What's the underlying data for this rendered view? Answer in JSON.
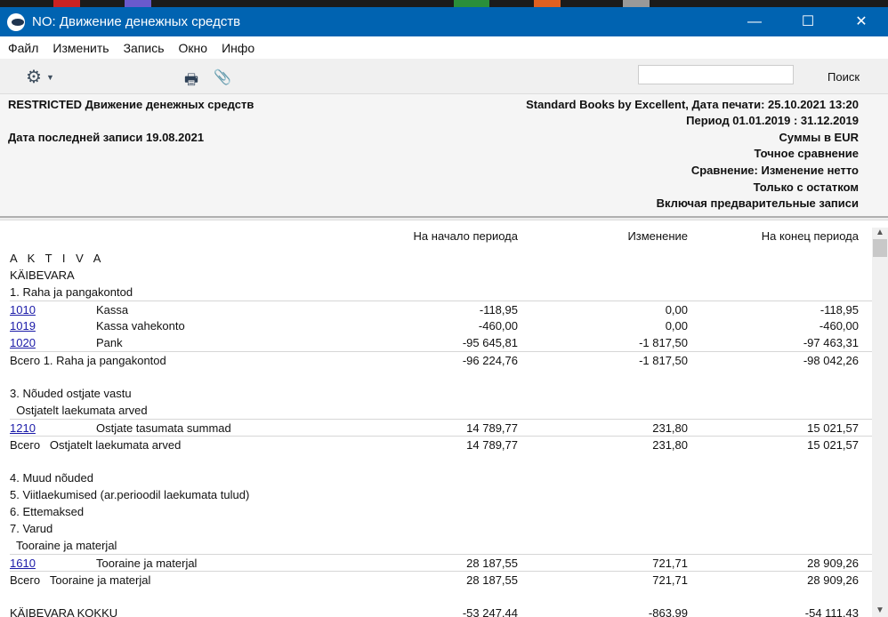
{
  "window": {
    "title": "NO: Движение денежных средств",
    "minimize": "—",
    "maximize": "☐",
    "close": "✕"
  },
  "menu": [
    "Файл",
    "Изменить",
    "Запись",
    "Окно",
    "Инфо"
  ],
  "toolbar": {
    "search_value": "",
    "search_label": "Поиск"
  },
  "report_header": {
    "title": "RESTRICTED Движение денежных средств",
    "last_entry": "Дата последней записи  19.08.2021",
    "right": [
      "Standard Books by Excellent, Дата печати: 25.10.2021 13:20",
      "Период  01.01.2019 : 31.12.2019",
      "Суммы в EUR",
      "Точное сравнение",
      "Сравнение: Изменение нетто",
      "Только с остатком",
      "Включая предварительные записи"
    ]
  },
  "columns": [
    "На начало периода",
    "Изменение",
    "На конец периода"
  ],
  "rows": [
    {
      "type": "spaced",
      "label": "A K T I V A"
    },
    {
      "type": "text",
      "label": "KÄIBEVARA"
    },
    {
      "type": "text",
      "label": "1. Raha ja pangakontod"
    },
    {
      "type": "account",
      "line": true,
      "code": "1010",
      "name": "Kassa",
      "v": [
        "-118,95",
        "0,00",
        "-118,95"
      ]
    },
    {
      "type": "account",
      "code": "1019",
      "name": "Kassa vahekonto",
      "v": [
        "-460,00",
        "0,00",
        "-460,00"
      ]
    },
    {
      "type": "account",
      "code": "1020",
      "name": "Pank",
      "v": [
        "-95 645,81",
        "-1 817,50",
        "-97 463,31"
      ]
    },
    {
      "type": "total",
      "line": true,
      "label": "Всего 1. Raha ja pangakontod",
      "v": [
        "-96 224,76",
        "-1 817,50",
        "-98 042,26"
      ]
    },
    {
      "type": "blank"
    },
    {
      "type": "text",
      "label": "3. Nõuded ostjate vastu"
    },
    {
      "type": "text",
      "label": "  Ostjatelt laekumata arved"
    },
    {
      "type": "account",
      "line": true,
      "code": "1210",
      "name": "Ostjate tasumata summad",
      "v": [
        "14 789,77",
        "231,80",
        "15 021,57"
      ]
    },
    {
      "type": "total",
      "line": true,
      "label": "Всего   Ostjatelt laekumata arved",
      "v": [
        "14 789,77",
        "231,80",
        "15 021,57"
      ]
    },
    {
      "type": "blank"
    },
    {
      "type": "text",
      "label": "4. Muud nõuded"
    },
    {
      "type": "text",
      "label": "5. Viitlaekumised (ar.perioodil laekumata tulud)"
    },
    {
      "type": "text",
      "label": "6. Ettemaksed"
    },
    {
      "type": "text",
      "label": "7. Varud"
    },
    {
      "type": "text",
      "label": "  Tooraine ja materjal"
    },
    {
      "type": "account",
      "line": true,
      "code": "1610",
      "name": "Tooraine ja materjal",
      "v": [
        "28 187,55",
        "721,71",
        "28 909,26"
      ]
    },
    {
      "type": "total",
      "line": true,
      "label": "Всего   Tooraine ja materjal",
      "v": [
        "28 187,55",
        "721,71",
        "28 909,26"
      ]
    },
    {
      "type": "blank"
    },
    {
      "type": "text",
      "label": "KÄIBEVARA KOKKU",
      "v": [
        "-53 247,44",
        "-863,99",
        "-54 111,43"
      ]
    }
  ]
}
